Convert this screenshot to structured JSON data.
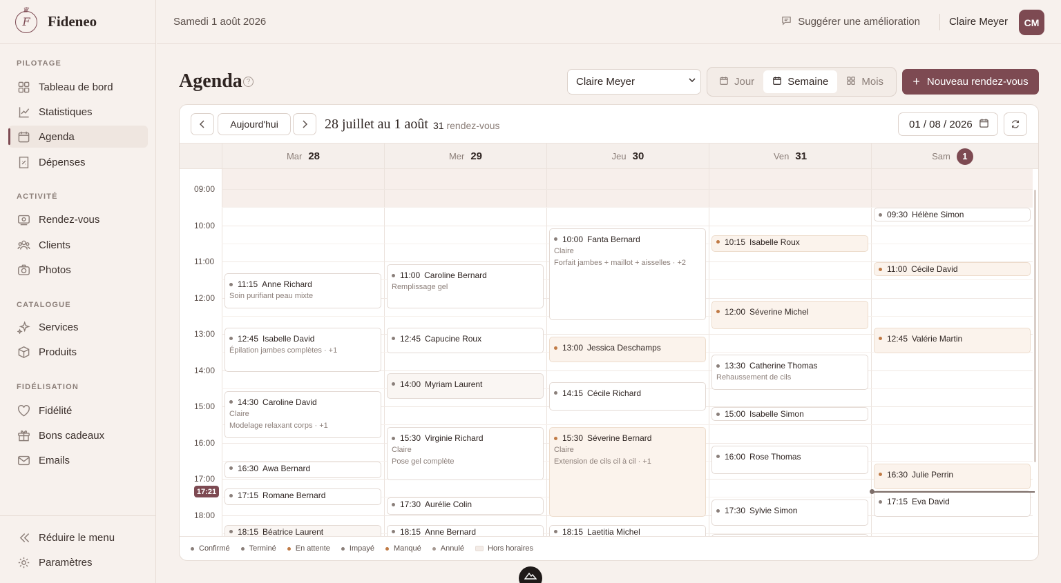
{
  "brand": {
    "name": "Fideneo",
    "logo_letter": "F"
  },
  "sidebar": {
    "sections": [
      {
        "title": "PILOTAGE",
        "items": [
          {
            "label": "Tableau de bord",
            "icon": "dashboard-icon"
          },
          {
            "label": "Statistiques",
            "icon": "chart-icon"
          },
          {
            "label": "Agenda",
            "icon": "calendar-icon",
            "active": true
          },
          {
            "label": "Dépenses",
            "icon": "receipt-icon"
          }
        ]
      },
      {
        "title": "ACTIVITÉ",
        "items": [
          {
            "label": "Rendez-vous",
            "icon": "appointment-icon"
          },
          {
            "label": "Clients",
            "icon": "users-icon"
          },
          {
            "label": "Photos",
            "icon": "camera-icon"
          }
        ]
      },
      {
        "title": "CATALOGUE",
        "items": [
          {
            "label": "Services",
            "icon": "sparkles-icon"
          },
          {
            "label": "Produits",
            "icon": "box-icon"
          }
        ]
      },
      {
        "title": "FIDÉLISATION",
        "items": [
          {
            "label": "Fidélité",
            "icon": "heart-icon"
          },
          {
            "label": "Bons cadeaux",
            "icon": "gift-icon"
          },
          {
            "label": "Emails",
            "icon": "mail-icon"
          }
        ]
      }
    ],
    "bottom": [
      {
        "label": "Réduire le menu",
        "icon": "collapse-icon"
      },
      {
        "label": "Paramètres",
        "icon": "settings-icon"
      }
    ]
  },
  "topbar": {
    "date": "Samedi 1 août 2026",
    "suggest": "Suggérer une amélioration",
    "user_name": "Claire Meyer",
    "user_initials": "CM"
  },
  "header": {
    "title": "Agenda",
    "staff_select": "Claire Meyer",
    "views": [
      "Jour",
      "Semaine",
      "Mois"
    ],
    "active_view": "Semaine",
    "new_button": "Nouveau rendez-vous"
  },
  "calendar": {
    "today_button": "Aujourd'hui",
    "range_title": "28 juillet au 1 août",
    "count": "31",
    "count_label": "rendez-vous",
    "date_value": "01 / 08 / 2026",
    "days": [
      {
        "name": "Mar",
        "num": "28"
      },
      {
        "name": "Mer",
        "num": "29"
      },
      {
        "name": "Jeu",
        "num": "30"
      },
      {
        "name": "Ven",
        "num": "31"
      },
      {
        "name": "Sam",
        "num": "1",
        "today": true
      }
    ],
    "hours": [
      "09:00",
      "10:00",
      "11:00",
      "12:00",
      "13:00",
      "14:00",
      "15:00",
      "16:00",
      "17:00",
      "18:00"
    ],
    "now_label": "17:21",
    "events": [
      {
        "day": 0,
        "start": "11:15",
        "end": "12:15",
        "name": "Anne Richard",
        "sub": [
          "Soin purifiant peau mixte"
        ],
        "status": "confirmed"
      },
      {
        "day": 0,
        "start": "12:45",
        "end": "14:00",
        "name": "Isabelle David",
        "sub": [
          "Épilation jambes complètes · +1"
        ],
        "status": "confirmed"
      },
      {
        "day": 0,
        "start": "14:30",
        "end": "15:50",
        "name": "Caroline David",
        "sub": [
          "Claire",
          "Modelage relaxant corps · +1"
        ],
        "status": "confirmed"
      },
      {
        "day": 0,
        "start": "16:30",
        "end": "17:00",
        "name": "Awa Bernard",
        "sub": [],
        "status": "confirmed",
        "compact": true
      },
      {
        "day": 0,
        "start": "17:15",
        "end": "17:45",
        "name": "Romane Bernard",
        "sub": [],
        "status": "confirmed",
        "compact": true
      },
      {
        "day": 0,
        "start": "18:15",
        "end": "18:45",
        "name": "Béatrice Laurent",
        "sub": [],
        "status": "done",
        "compact": true
      },
      {
        "day": 1,
        "start": "11:00",
        "end": "12:15",
        "name": "Caroline Bernard",
        "sub": [
          "Remplissage gel"
        ],
        "status": "confirmed"
      },
      {
        "day": 1,
        "start": "12:45",
        "end": "13:30",
        "name": "Capucine Roux",
        "sub": [],
        "status": "confirmed"
      },
      {
        "day": 1,
        "start": "14:00",
        "end": "14:45",
        "name": "Myriam Laurent",
        "sub": [],
        "status": "done"
      },
      {
        "day": 1,
        "start": "15:30",
        "end": "17:00",
        "name": "Virginie Richard",
        "sub": [
          "Claire",
          "Pose gel complète"
        ],
        "status": "confirmed"
      },
      {
        "day": 1,
        "start": "17:30",
        "end": "18:00",
        "name": "Aurélie Colin",
        "sub": [],
        "status": "confirmed",
        "compact": true
      },
      {
        "day": 1,
        "start": "18:15",
        "end": "18:45",
        "name": "Anne Bernard",
        "sub": [],
        "status": "confirmed",
        "compact": true
      },
      {
        "day": 2,
        "start": "10:00",
        "end": "12:35",
        "name": "Fanta Bernard",
        "sub": [
          "Claire",
          "Forfait jambes + maillot + aisselles · +2"
        ],
        "status": "confirmed"
      },
      {
        "day": 2,
        "start": "13:00",
        "end": "13:45",
        "name": "Jessica Deschamps",
        "sub": [],
        "status": "pending"
      },
      {
        "day": 2,
        "start": "14:15",
        "end": "15:05",
        "name": "Cécile Richard",
        "sub": [],
        "status": "confirmed"
      },
      {
        "day": 2,
        "start": "15:30",
        "end": "18:00",
        "name": "Séverine Bernard",
        "sub": [
          "Claire",
          "Extension de cils cil à cil · +1"
        ],
        "status": "pending"
      },
      {
        "day": 2,
        "start": "18:15",
        "end": "18:45",
        "name": "Laetitia Michel",
        "sub": [],
        "status": "confirmed",
        "compact": true
      },
      {
        "day": 3,
        "start": "10:15",
        "end": "10:45",
        "name": "Isabelle Roux",
        "sub": [],
        "status": "pending",
        "compact": true
      },
      {
        "day": 3,
        "start": "12:00",
        "end": "12:50",
        "name": "Séverine Michel",
        "sub": [],
        "status": "pending"
      },
      {
        "day": 3,
        "start": "13:30",
        "end": "14:30",
        "name": "Catherine Thomas",
        "sub": [
          "Rehaussement de cils"
        ],
        "status": "confirmed"
      },
      {
        "day": 3,
        "start": "15:00",
        "end": "15:25",
        "name": "Isabelle Simon",
        "sub": [],
        "status": "confirmed",
        "compact": true
      },
      {
        "day": 3,
        "start": "16:00",
        "end": "16:50",
        "name": "Rose Thomas",
        "sub": [],
        "status": "confirmed"
      },
      {
        "day": 3,
        "start": "17:30",
        "end": "18:15",
        "name": "Sylvie Simon",
        "sub": [],
        "status": "confirmed"
      },
      {
        "day": 3,
        "start": "18:30",
        "end": "19:00",
        "name": "",
        "sub": [],
        "status": "confirmed",
        "compact": true
      },
      {
        "day": 4,
        "start": "09:30",
        "end": "09:55",
        "name": "Hélène Simon",
        "sub": [],
        "status": "confirmed",
        "compact": true
      },
      {
        "day": 4,
        "start": "11:00",
        "end": "11:25",
        "name": "Cécile David",
        "sub": [],
        "status": "pending",
        "compact": true
      },
      {
        "day": 4,
        "start": "12:45",
        "end": "13:30",
        "name": "Valérie Martin",
        "sub": [],
        "status": "pending"
      },
      {
        "day": 4,
        "start": "16:30",
        "end": "17:15",
        "name": "Julie Perrin",
        "sub": [],
        "status": "pending"
      },
      {
        "day": 4,
        "start": "17:15",
        "end": "18:00",
        "name": "Eva David",
        "sub": [],
        "status": "confirmed"
      }
    ],
    "legend": [
      {
        "label": "Confirmé",
        "color": "#8a7f7a"
      },
      {
        "label": "Terminé",
        "color": "#8a7f7a"
      },
      {
        "label": "En attente",
        "color": "#c07a45"
      },
      {
        "label": "Impayé",
        "color": "#8a7f7a"
      },
      {
        "label": "Manqué",
        "color": "#c07a45"
      },
      {
        "label": "Annulé",
        "color": "#a59891"
      },
      {
        "label": "Hors horaires",
        "box": true
      }
    ]
  },
  "colors": {
    "accent": "#7d4a52",
    "background": "#f7f1ed",
    "pending": "#c07a45"
  }
}
